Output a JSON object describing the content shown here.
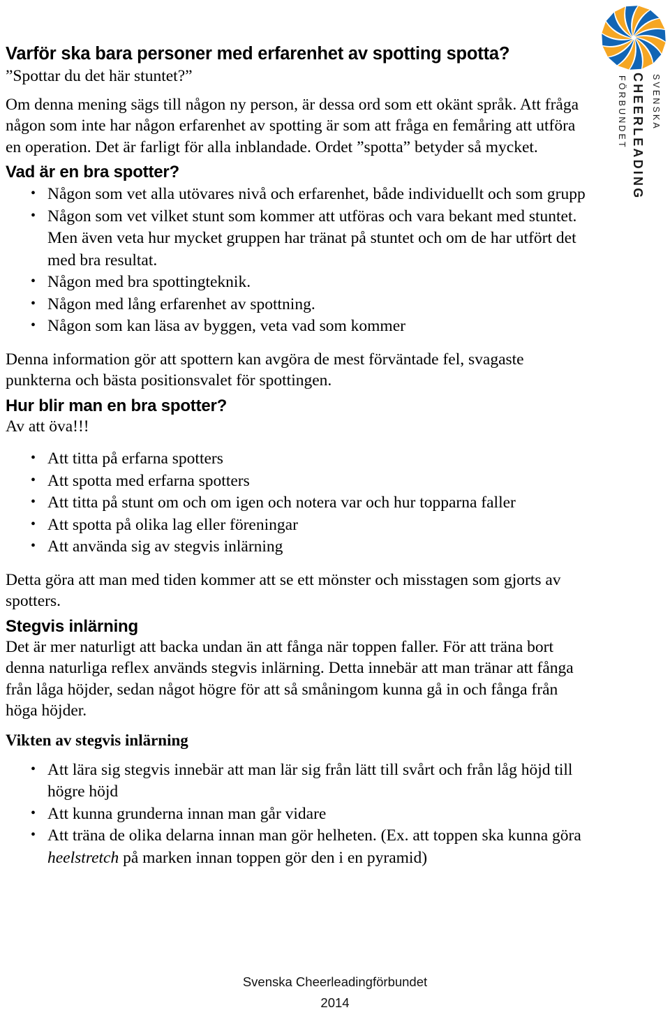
{
  "logo": {
    "mark_name": "pinwheel-starburst-logo",
    "blade_count": 16,
    "colors": {
      "blue": "#1165B5",
      "gold": "#F5A623"
    },
    "line_top": "SVENSKA",
    "line_mid": "CHEERLEADING",
    "line_bottom": "FÖRBUNDET"
  },
  "doc": {
    "title": "Varför ska bara personer med erfarenhet av spotting spotta?",
    "quote": "”Spottar du det här stuntet?”",
    "intro": "Om denna mening sägs till någon ny person, är dessa ord som ett okänt språk. Att fråga någon som inte har någon erfarenhet av spotting är som att fråga en femåring att utföra en operation. Det är farligt för alla inblandade. Ordet ”spotta” betyder så mycket.",
    "heading_vad": "Vad är en bra spotter?",
    "bullets_vad": [
      "Någon som vet alla utövares nivå och erfarenhet, både individuellt och som grupp",
      "Någon som vet vilket stunt som kommer att utföras och vara bekant med stuntet. Men även veta hur mycket gruppen har tränat på stuntet och om de har utfört det med bra resultat.",
      "Någon med bra spottingteknik.",
      "Någon med lång erfarenhet av spottning.",
      "Någon som kan läsa av byggen, veta vad som kommer"
    ],
    "para_denna": "Denna information gör att spottern kan avgöra de mest förväntade fel, svagaste punkterna och bästa positionsvalet för spottingen.",
    "heading_hur": "Hur blir man en bra spotter?",
    "para_av_att_ova": "Av att öva!!!",
    "bullets_hur": [
      "Att titta på erfarna spotters",
      "Att spotta med erfarna spotters",
      "Att titta på stunt om och om igen och notera var och hur topparna faller",
      "Att spotta på olika lag eller föreningar",
      "Att använda sig av stegvis inlärning"
    ],
    "para_detta": "Detta göra att man med tiden kommer att se ett mönster och misstagen som gjorts av spotters.",
    "heading_stegvis": "Stegvis inlärning",
    "para_stegvis": "Det är mer naturligt att backa undan än att fånga när toppen faller. För att träna bort denna naturliga reflex används stegvis inlärning. Detta innebär att man tränar att fånga från låga höjder, sedan något högre för att så småningom kunna gå in och fånga från höga höjder.",
    "heading_vikten": "Vikten av stegvis inlärning",
    "bullets_vikten_1": "Att lära sig stegvis innebär att man lär sig från lätt till svårt och från låg höjd till högre höjd",
    "bullets_vikten_2": "Att kunna grunderna innan man går vidare",
    "bullets_vikten_3_a": "Att träna de olika delarna innan man gör helheten. (Ex. att toppen ska kunna göra ",
    "bullets_vikten_3_italic": "heelstretch",
    "bullets_vikten_3_b": " på marken innan toppen gör den i en pyramid)"
  },
  "footer": {
    "organisation": "Svenska Cheerleadingförbundet",
    "year": "2014"
  }
}
